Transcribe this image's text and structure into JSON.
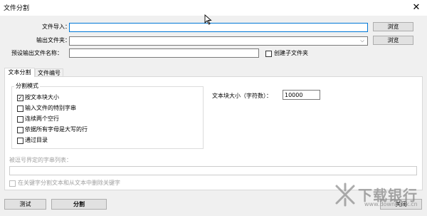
{
  "window": {
    "title": "文件分割",
    "close_glyph": "✕"
  },
  "import": {
    "label": "文件导入：",
    "value": "",
    "browse": "浏览"
  },
  "output": {
    "label": "输出文件夹：",
    "value": "",
    "browse": "浏览"
  },
  "preset": {
    "label": "预设输出文件名称：",
    "value": "",
    "subfolder_label": "创建子文件夹",
    "subfolder_checked": false
  },
  "tabs": [
    {
      "label": "文本分割",
      "active": true
    },
    {
      "label": "文件编号",
      "active": false
    }
  ],
  "split_mode": {
    "group_label": "分割模式",
    "options": [
      {
        "label": "按文本块大小",
        "checked": true
      },
      {
        "label": "输入文件的特别字串",
        "checked": false
      },
      {
        "label": "连续两个空行",
        "checked": false
      },
      {
        "label": "依据所有字母是大写的行",
        "checked": false
      },
      {
        "label": "通过目录",
        "checked": false
      }
    ]
  },
  "block_size": {
    "label": "文本块大小（字符数）：",
    "value": "10000"
  },
  "comma_list": {
    "label": "被逗号界定的字串列表：",
    "value": ""
  },
  "keyword_split": {
    "label": "在关键字分割文本和从文本中删除关键字",
    "checked": false
  },
  "buttons": {
    "test": "测试",
    "split": "分割",
    "close": "关闭"
  },
  "watermark": {
    "text": "下载银行",
    "url": "www.downbank.cn"
  }
}
